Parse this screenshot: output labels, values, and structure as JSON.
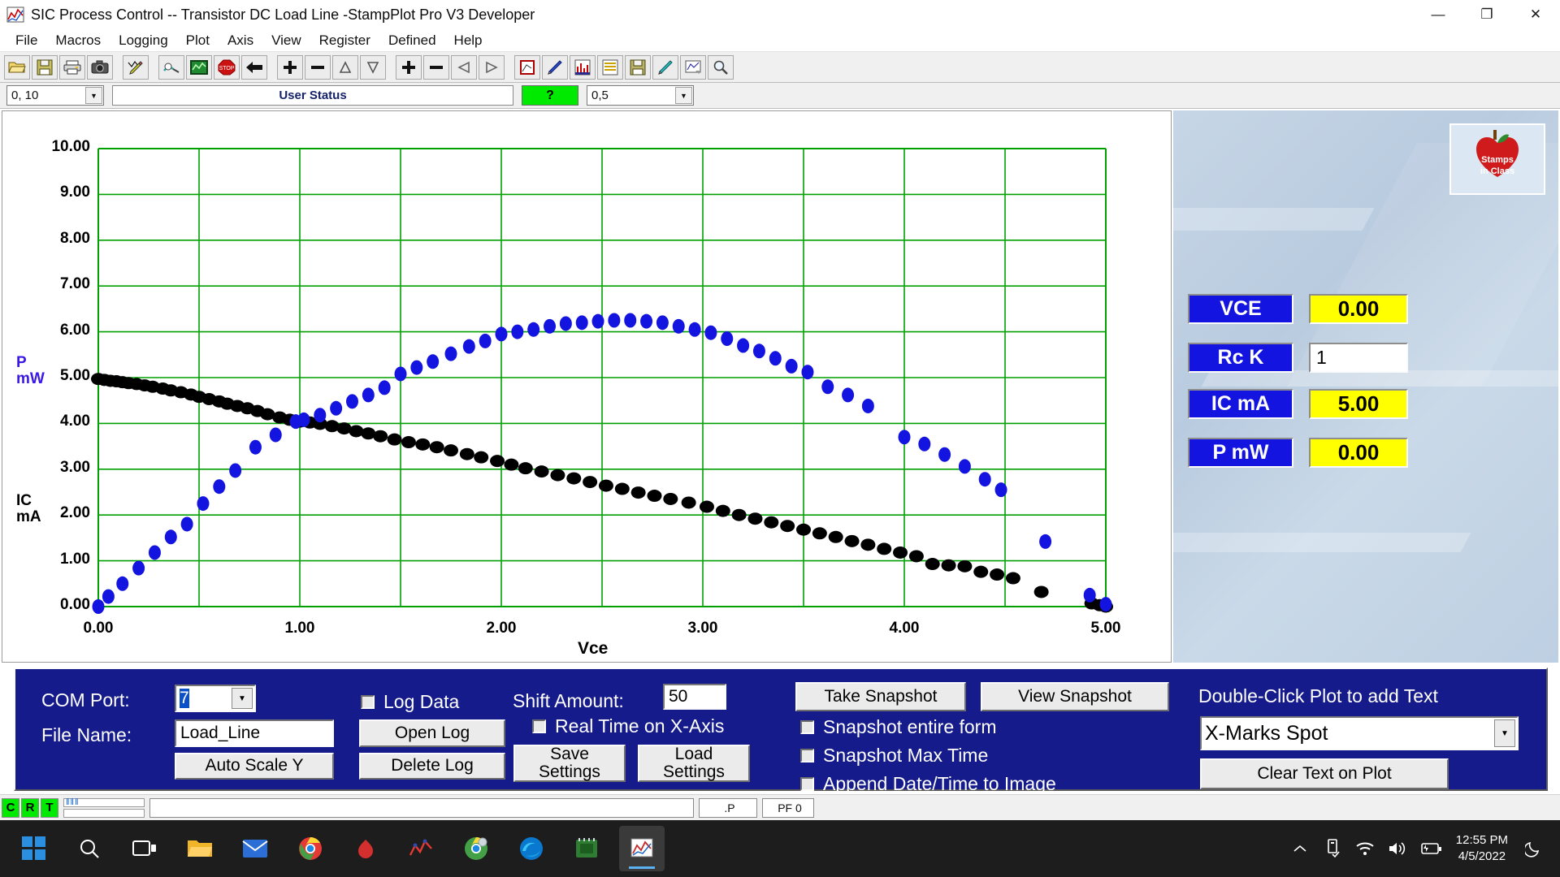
{
  "window": {
    "title": "SIC Process Control -- Transistor DC Load Line -StampPlot Pro V3 Developer",
    "minimize": "—",
    "maximize": "❐",
    "close": "✕"
  },
  "menu": [
    "File",
    "Macros",
    "Logging",
    "Plot",
    "Axis",
    "View",
    "Register",
    "Defined",
    "Help"
  ],
  "toolbar": {
    "groups": [
      [
        "open-file-icon",
        "save-file-icon",
        "print-icon",
        "camera-icon"
      ],
      [
        "pencil-plot-icon"
      ],
      [
        "connect-icon",
        "run-plot-icon",
        "stop-icon",
        "back-arrow-icon"
      ],
      [
        "plus-icon",
        "minus-icon",
        "scale-up-icon",
        "scale-down-icon"
      ],
      [
        "plus2-icon",
        "minus2-icon",
        "pan-left-icon",
        "pan-right-icon"
      ],
      [
        "axis-icon"
      ],
      [
        "pen-icon",
        "data-icon",
        "notes-icon",
        "save-plot-icon",
        "marker-icon",
        "export-icon",
        "zoom-tool-icon"
      ]
    ]
  },
  "statusrow": {
    "range_value": "0, 10",
    "user_status_label": "User Status",
    "indicator": "?",
    "interval_value": "0,5"
  },
  "plot": {
    "y_label_power": "P\nmW",
    "y_label_power_line1": "P",
    "y_label_power_line2": "mW",
    "y_label_current_line1": "IC",
    "y_label_current_line2": "mA",
    "x_axis_title": "Vce"
  },
  "readouts": [
    {
      "label": "VCE",
      "value": "0.00",
      "type": "display"
    },
    {
      "label": "Rc K",
      "value": "1",
      "type": "input"
    },
    {
      "label": "IC mA",
      "value": "5.00",
      "type": "display"
    },
    {
      "label": "P mW",
      "value": "0.00",
      "type": "display"
    }
  ],
  "logo_text": "Stamps in Class",
  "controls": {
    "com_port_label": "COM Port:",
    "com_port_value": "7",
    "file_name_label": "File Name:",
    "file_name_value": "Load_Line",
    "auto_scale_y": "Auto Scale Y",
    "log_data": "Log Data",
    "open_log": "Open Log",
    "delete_log": "Delete Log",
    "shift_amount_label": "Shift Amount:",
    "shift_amount_value": "50",
    "real_time_x": "Real Time on X-Axis",
    "save_settings_l1": "Save",
    "save_settings_l2": "Settings",
    "load_settings_l1": "Load",
    "load_settings_l2": "Settings",
    "take_snapshot": "Take Snapshot",
    "view_snapshot": "View Snapshot",
    "snapshot_entire_form": "Snapshot entire form",
    "snapshot_max_time": "Snapshot Max Time",
    "append_datetime": "Append Date/Time to Image",
    "double_click_hint": "Double-Click Plot to add Text",
    "text_mode_value": "X-Marks Spot",
    "clear_text": "Clear Text on Plot"
  },
  "statusbar": {
    "c": "C",
    "r": "R",
    "t": "T",
    "ticks": "‖‖‖",
    "message": "",
    "field_p": ".P",
    "field_pf": "PF 0"
  },
  "taskbar": {
    "start": "start-icon",
    "items": [
      "search-icon",
      "task-view-icon",
      "file-explorer-icon",
      "mail-icon",
      "chrome-icon",
      "red-teardrop-icon",
      "red-graph-icon",
      "chrome-dev-icon",
      "edge-icon",
      "circuit-board-icon",
      "stampplot-icon"
    ],
    "tray": [
      "chevron-up-icon",
      "usb-icon",
      "wifi-icon",
      "volume-icon",
      "battery-icon"
    ],
    "time": "12:55 PM",
    "date": "4/5/2022",
    "moon": "moon-icon"
  },
  "colors": {
    "grid": "#00a000",
    "power_series": "#1414e0",
    "current_series": "#000000",
    "panel_blue": "#151b8b",
    "readout_yellow": "#ffff00",
    "indicator_green": "#00ea00"
  },
  "chart_data": {
    "type": "scatter",
    "title": "",
    "xlabel": "Vce",
    "ylabel": "IC mA / P mW",
    "xlim": [
      0,
      5
    ],
    "ylim": [
      0,
      10
    ],
    "xticks": [
      "0.00",
      "1.00",
      "2.00",
      "3.00",
      "4.00",
      "5.00"
    ],
    "yticks": [
      "0.00",
      "1.00",
      "2.00",
      "3.00",
      "4.00",
      "5.00",
      "6.00",
      "7.00",
      "8.00",
      "9.00",
      "10.00"
    ],
    "grid": true,
    "legend": "none",
    "series": [
      {
        "name": "IC mA",
        "color": "#000000",
        "axis": "left",
        "points": [
          [
            0.0,
            4.97
          ],
          [
            0.03,
            4.95
          ],
          [
            0.06,
            4.93
          ],
          [
            0.09,
            4.92
          ],
          [
            0.12,
            4.9
          ],
          [
            0.15,
            4.88
          ],
          [
            0.19,
            4.86
          ],
          [
            0.23,
            4.83
          ],
          [
            0.27,
            4.8
          ],
          [
            0.32,
            4.76
          ],
          [
            0.36,
            4.72
          ],
          [
            0.41,
            4.68
          ],
          [
            0.46,
            4.63
          ],
          [
            0.5,
            4.58
          ],
          [
            0.55,
            4.53
          ],
          [
            0.6,
            4.48
          ],
          [
            0.64,
            4.43
          ],
          [
            0.69,
            4.38
          ],
          [
            0.74,
            4.33
          ],
          [
            0.79,
            4.27
          ],
          [
            0.84,
            4.2
          ],
          [
            0.9,
            4.13
          ],
          [
            0.95,
            4.08
          ],
          [
            1.0,
            4.04
          ],
          [
            1.05,
            4.02
          ],
          [
            1.1,
            3.99
          ],
          [
            1.16,
            3.94
          ],
          [
            1.22,
            3.89
          ],
          [
            1.28,
            3.83
          ],
          [
            1.34,
            3.78
          ],
          [
            1.4,
            3.72
          ],
          [
            1.47,
            3.65
          ],
          [
            1.54,
            3.59
          ],
          [
            1.61,
            3.54
          ],
          [
            1.68,
            3.48
          ],
          [
            1.75,
            3.41
          ],
          [
            1.83,
            3.33
          ],
          [
            1.9,
            3.26
          ],
          [
            1.98,
            3.18
          ],
          [
            2.05,
            3.1
          ],
          [
            2.12,
            3.02
          ],
          [
            2.2,
            2.95
          ],
          [
            2.28,
            2.87
          ],
          [
            2.36,
            2.8
          ],
          [
            2.44,
            2.72
          ],
          [
            2.52,
            2.64
          ],
          [
            2.6,
            2.57
          ],
          [
            2.68,
            2.49
          ],
          [
            2.76,
            2.42
          ],
          [
            2.84,
            2.35
          ],
          [
            2.93,
            2.27
          ],
          [
            3.02,
            2.18
          ],
          [
            3.1,
            2.09
          ],
          [
            3.18,
            2.0
          ],
          [
            3.26,
            1.92
          ],
          [
            3.34,
            1.84
          ],
          [
            3.42,
            1.76
          ],
          [
            3.5,
            1.68
          ],
          [
            3.58,
            1.6
          ],
          [
            3.66,
            1.52
          ],
          [
            3.74,
            1.43
          ],
          [
            3.82,
            1.35
          ],
          [
            3.9,
            1.26
          ],
          [
            3.98,
            1.18
          ],
          [
            4.06,
            1.1
          ],
          [
            4.14,
            0.93
          ],
          [
            4.22,
            0.9
          ],
          [
            4.3,
            0.88
          ],
          [
            4.38,
            0.76
          ],
          [
            4.46,
            0.7
          ],
          [
            4.54,
            0.62
          ],
          [
            4.68,
            0.32
          ],
          [
            4.93,
            0.07
          ],
          [
            4.97,
            0.03
          ],
          [
            5.0,
            0.0
          ]
        ]
      },
      {
        "name": "P mW",
        "color": "#1414e0",
        "axis": "left",
        "points": [
          [
            0.0,
            0.0
          ],
          [
            0.05,
            0.22
          ],
          [
            0.12,
            0.5
          ],
          [
            0.2,
            0.84
          ],
          [
            0.28,
            1.18
          ],
          [
            0.36,
            1.52
          ],
          [
            0.44,
            1.8
          ],
          [
            0.52,
            2.25
          ],
          [
            0.6,
            2.62
          ],
          [
            0.68,
            2.97
          ],
          [
            0.78,
            3.48
          ],
          [
            0.88,
            3.75
          ],
          [
            0.98,
            4.04
          ],
          [
            1.02,
            4.08
          ],
          [
            1.1,
            4.18
          ],
          [
            1.18,
            4.33
          ],
          [
            1.26,
            4.48
          ],
          [
            1.34,
            4.62
          ],
          [
            1.42,
            4.78
          ],
          [
            1.5,
            5.08
          ],
          [
            1.58,
            5.22
          ],
          [
            1.66,
            5.35
          ],
          [
            1.75,
            5.52
          ],
          [
            1.84,
            5.68
          ],
          [
            1.92,
            5.8
          ],
          [
            2.0,
            5.95
          ],
          [
            2.08,
            6.0
          ],
          [
            2.16,
            6.05
          ],
          [
            2.24,
            6.12
          ],
          [
            2.32,
            6.18
          ],
          [
            2.4,
            6.2
          ],
          [
            2.48,
            6.23
          ],
          [
            2.56,
            6.25
          ],
          [
            2.64,
            6.25
          ],
          [
            2.72,
            6.23
          ],
          [
            2.8,
            6.2
          ],
          [
            2.88,
            6.12
          ],
          [
            2.96,
            6.05
          ],
          [
            3.04,
            5.98
          ],
          [
            3.12,
            5.85
          ],
          [
            3.2,
            5.7
          ],
          [
            3.28,
            5.58
          ],
          [
            3.36,
            5.42
          ],
          [
            3.44,
            5.25
          ],
          [
            3.52,
            5.12
          ],
          [
            3.62,
            4.8
          ],
          [
            3.72,
            4.62
          ],
          [
            3.82,
            4.38
          ],
          [
            4.0,
            3.7
          ],
          [
            4.1,
            3.55
          ],
          [
            4.2,
            3.32
          ],
          [
            4.3,
            3.06
          ],
          [
            4.4,
            2.78
          ],
          [
            4.48,
            2.55
          ],
          [
            4.7,
            1.42
          ],
          [
            4.92,
            0.25
          ],
          [
            5.0,
            0.05
          ]
        ]
      }
    ]
  }
}
